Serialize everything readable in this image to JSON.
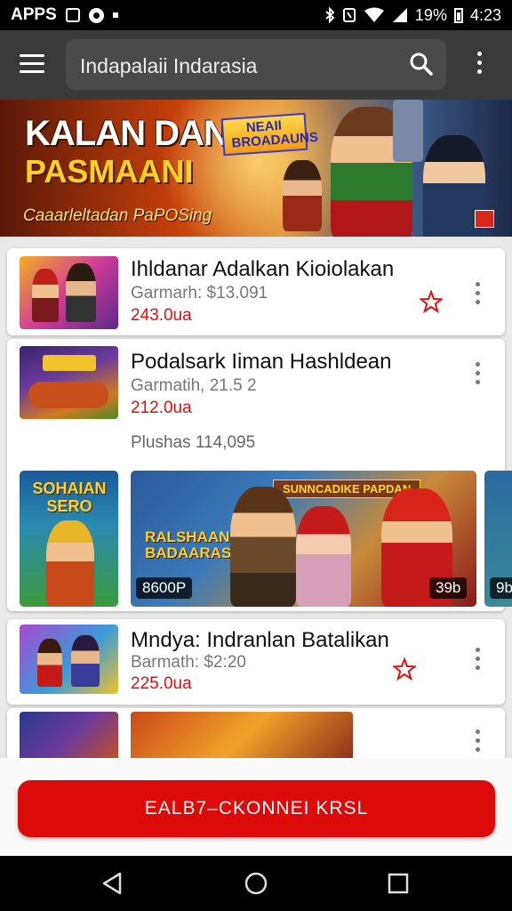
{
  "status_bar": {
    "app_label": "APPS",
    "battery": "19%",
    "time": "4:23"
  },
  "app_bar": {
    "search_text": "Indapalaii Indarasia"
  },
  "banner": {
    "title_line1": "KALAN DAN",
    "title_line2": "PASMAANI",
    "badge": "NEAII BROADAUNS",
    "subtitle": "Caaarleltadan PaPOSing"
  },
  "items": [
    {
      "title": "Ihldanar Adalkan Kioiolakan",
      "subtitle": "Garmarh: $13.091",
      "price": "243.0ua"
    },
    {
      "title": "Podalsark Iiman Hashldean",
      "subtitle": "Garmatih, 21.5 2",
      "price": "212.0ua"
    },
    {
      "title": "Mndya: Indranlan Batalikan",
      "subtitle": "Barmath: $2:20",
      "price": "225.0ua"
    }
  ],
  "carousel": {
    "label": "Plushas 114,095",
    "tile1_title": "SOHAIAN SERO",
    "tile2_title": "RALSHAAN BADAARAS",
    "tile2_banner": "SUNNCADIKE PAPDAN",
    "tile2_badge_left": "8600P",
    "tile2_badge_right": "39b",
    "tile3_badge": "9b"
  },
  "cta": {
    "label": "EALB7–CKONNEI KRSL"
  },
  "colors": {
    "accent": "#dd0a0a",
    "app_bar": "#3a3a3a",
    "price": "#dd1111",
    "star": "#dd1111"
  }
}
